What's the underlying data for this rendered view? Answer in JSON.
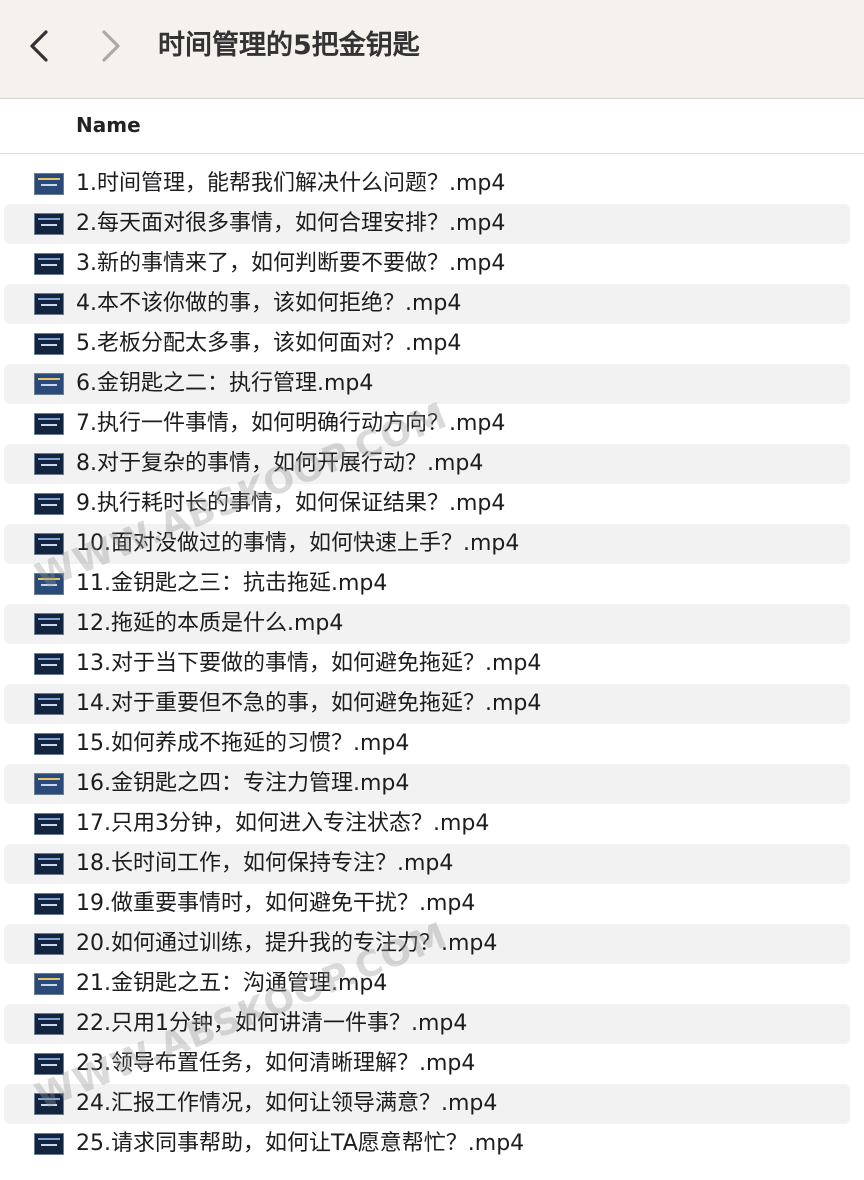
{
  "window": {
    "title": "时间管理的5把金钥匙"
  },
  "columns": {
    "name": "Name"
  },
  "files": [
    {
      "name": "1.时间管理，能帮我们解决什么问题？.mp4",
      "icon": "video-thumbnail-title-icon"
    },
    {
      "name": "2.每天面对很多事情，如何合理安排？.mp4",
      "icon": "video-thumbnail-icon"
    },
    {
      "name": "3.新的事情来了，如何判断要不要做？.mp4",
      "icon": "video-thumbnail-icon"
    },
    {
      "name": "4.本不该你做的事，该如何拒绝？.mp4",
      "icon": "video-thumbnail-icon"
    },
    {
      "name": "5.老板分配太多事，该如何面对？.mp4",
      "icon": "video-thumbnail-icon"
    },
    {
      "name": "6.金钥匙之二：执行管理.mp4",
      "icon": "video-thumbnail-title-icon"
    },
    {
      "name": "7.执行一件事情，如何明确行动方向？.mp4",
      "icon": "video-thumbnail-icon"
    },
    {
      "name": "8.对于复杂的事情，如何开展行动？.mp4",
      "icon": "video-thumbnail-icon"
    },
    {
      "name": "9.执行耗时长的事情，如何保证结果？.mp4",
      "icon": "video-thumbnail-icon"
    },
    {
      "name": "10.面对没做过的事情，如何快速上手？.mp4",
      "icon": "video-thumbnail-icon"
    },
    {
      "name": "11.金钥匙之三：抗击拖延.mp4",
      "icon": "video-thumbnail-title-icon"
    },
    {
      "name": "12.拖延的本质是什么.mp4",
      "icon": "video-thumbnail-icon"
    },
    {
      "name": "13.对于当下要做的事情，如何避免拖延？.mp4",
      "icon": "video-thumbnail-icon"
    },
    {
      "name": "14.对于重要但不急的事，如何避免拖延？.mp4",
      "icon": "video-thumbnail-icon"
    },
    {
      "name": "15.如何养成不拖延的习惯？.mp4",
      "icon": "video-thumbnail-icon"
    },
    {
      "name": "16.金钥匙之四：专注力管理.mp4",
      "icon": "video-thumbnail-title-icon"
    },
    {
      "name": "17.只用3分钟，如何进入专注状态？.mp4",
      "icon": "video-thumbnail-icon"
    },
    {
      "name": "18.长时间工作，如何保持专注？.mp4",
      "icon": "video-thumbnail-icon"
    },
    {
      "name": "19.做重要事情时，如何避免干扰？.mp4",
      "icon": "video-thumbnail-icon"
    },
    {
      "name": "20.如何通过训练，提升我的专注力？.mp4",
      "icon": "video-thumbnail-icon"
    },
    {
      "name": "21.金钥匙之五：沟通管理.mp4",
      "icon": "video-thumbnail-title-icon"
    },
    {
      "name": "22.只用1分钟，如何讲清一件事？.mp4",
      "icon": "video-thumbnail-icon"
    },
    {
      "name": "23.领导布置任务，如何清晰理解？.mp4",
      "icon": "video-thumbnail-icon"
    },
    {
      "name": "24.汇报工作情况，如何让领导满意？.mp4",
      "icon": "video-thumbnail-icon"
    },
    {
      "name": "25.请求同事帮助，如何让TA愿意帮忙？.mp4",
      "icon": "video-thumbnail-icon"
    }
  ],
  "watermarks": [
    "WWW.ABSKOOP.COM",
    "WWW.ABSKOOP.COM"
  ]
}
